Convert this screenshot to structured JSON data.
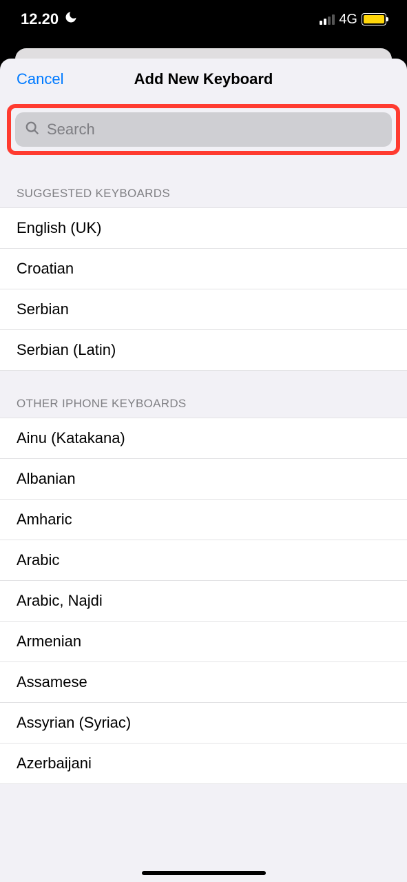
{
  "statusBar": {
    "time": "12.20",
    "network": "4G"
  },
  "nav": {
    "cancel": "Cancel",
    "title": "Add New Keyboard"
  },
  "search": {
    "placeholder": "Search"
  },
  "sections": {
    "suggested": {
      "header": "SUGGESTED KEYBOARDS",
      "items": [
        "English (UK)",
        "Croatian",
        "Serbian",
        "Serbian (Latin)"
      ]
    },
    "other": {
      "header": "OTHER IPHONE KEYBOARDS",
      "items": [
        "Ainu (Katakana)",
        "Albanian",
        "Amharic",
        "Arabic",
        "Arabic, Najdi",
        "Armenian",
        "Assamese",
        "Assyrian (Syriac)",
        "Azerbaijani"
      ]
    }
  }
}
